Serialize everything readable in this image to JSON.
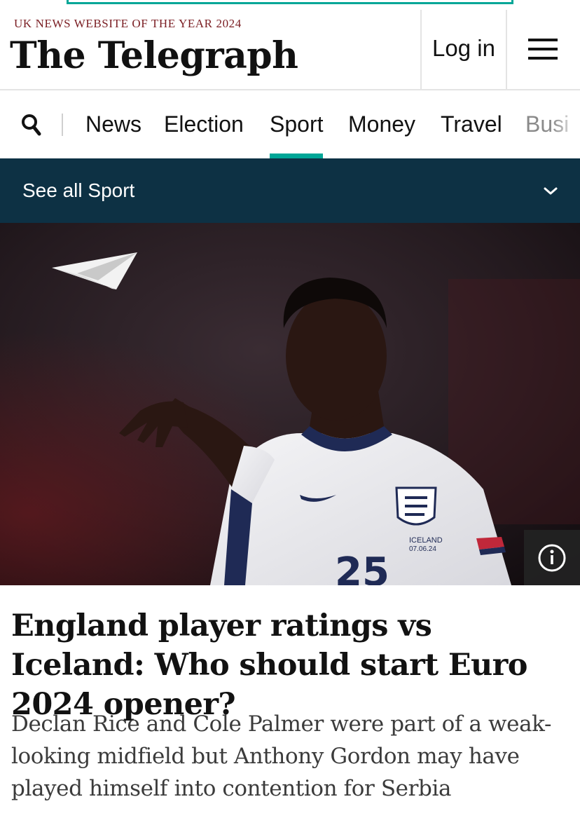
{
  "header": {
    "award": "UK NEWS WEBSITE OF THE YEAR 2024",
    "logo": "The Telegraph",
    "login_label": "Log in"
  },
  "nav": {
    "items": [
      {
        "label": "News"
      },
      {
        "label": "Election"
      },
      {
        "label": "Sport",
        "active": true
      },
      {
        "label": "Money"
      },
      {
        "label": "Travel"
      },
      {
        "label": "Busi"
      }
    ]
  },
  "section_bar": {
    "label": "See all Sport",
    "background": "#0d3144"
  },
  "hero": {
    "shirt_text": "ICELAND",
    "shirt_date": "07.06.24",
    "shirt_number": "25"
  },
  "article": {
    "headline": "England player ratings vs Iceland: Who should start Euro 2024 opener?",
    "standfirst": "Declan Rice and Cole Palmer were part of a weak-looking midfield but Anthony Gordon may have played himself into contention for Serbia"
  },
  "colors": {
    "accent": "#00a697",
    "award_red": "#7a1d22",
    "nav_bar": "#0d3144"
  }
}
